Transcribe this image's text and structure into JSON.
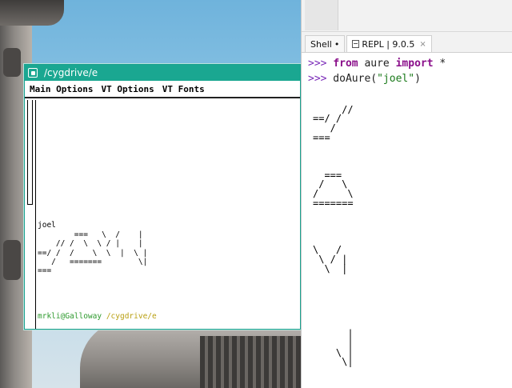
{
  "terminal": {
    "title": "/cygdrive/e",
    "menu": [
      "Main Options",
      "VT Options",
      "VT Fonts"
    ],
    "output_lines": [
      "joel",
      "        ===   \\  /    |",
      "    // /  \\  \\ / |    |",
      "==/ /  /    \\  \\  |  \\ |",
      "   /   =======        \\|",
      "==="
    ],
    "prompt_user": "mrkli@Galloway",
    "prompt_path": "/cygdrive/e",
    "prompt_symbol": "$"
  },
  "thonny": {
    "tabs": [
      {
        "label": "Shell",
        "marker": "•"
      },
      {
        "label": "REPL | 9.0.5",
        "close": "×"
      }
    ],
    "commands": [
      {
        "prompt": ">>>",
        "kw1": "from",
        "mid": " aure ",
        "kw2": "import",
        "rest": " *"
      },
      {
        "prompt": ">>>",
        "call": " doAure(",
        "arg": "\"joel\"",
        "end": ")"
      }
    ],
    "output_lines": [
      "",
      "     //",
      "==/ /",
      "   /",
      "===",
      "",
      "",
      "",
      "  ===",
      " /   \\",
      "/     \\",
      "=======",
      "",
      "",
      "",
      "",
      "\\   /",
      " \\ / |",
      "  \\  |",
      "",
      "",
      "",
      "",
      "",
      "",
      "      |",
      "      |",
      "    \\ |",
      "     \\|"
    ]
  }
}
